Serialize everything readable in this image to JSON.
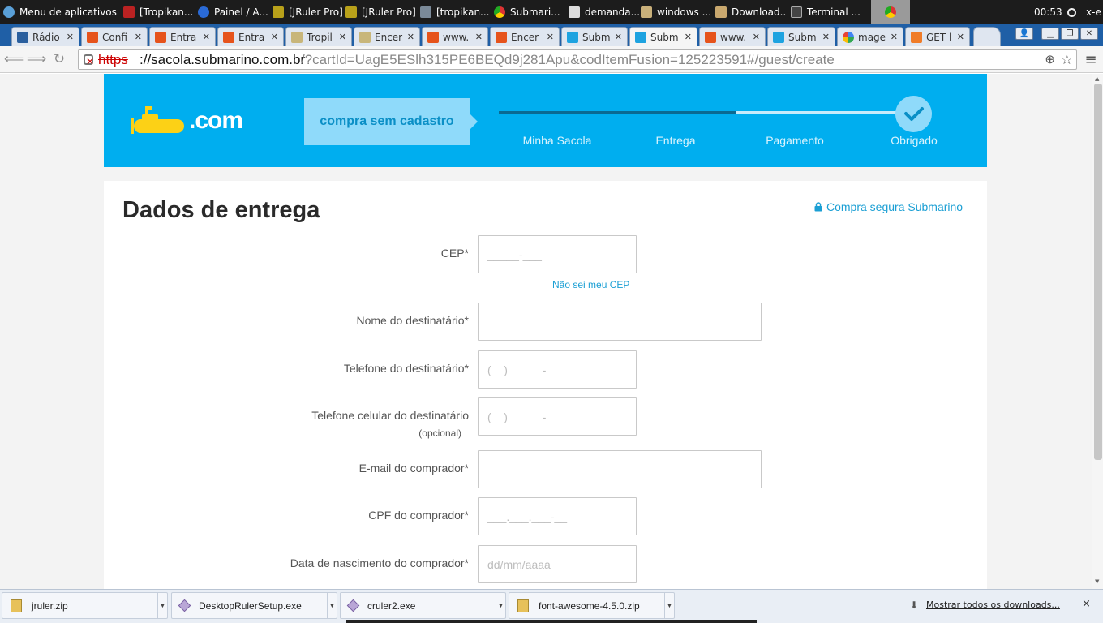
{
  "taskbar": {
    "apps_menu": "Menu de aplicativos",
    "items": [
      {
        "label": "[Tropikan..."
      },
      {
        "label": "Painel / A..."
      },
      {
        "label": "[JRuler Pro]"
      },
      {
        "label": "[JRuler Pro]"
      },
      {
        "label": "[tropikan..."
      },
      {
        "label": "Submari..."
      },
      {
        "label": "demanda..."
      },
      {
        "label": "windows ..."
      },
      {
        "label": "Download..."
      },
      {
        "label": "Terminal ..."
      }
    ],
    "clock": "00:53",
    "user": "x-e"
  },
  "tabs": [
    {
      "label": "Rádio"
    },
    {
      "label": "Confi"
    },
    {
      "label": "Entra"
    },
    {
      "label": "Entra"
    },
    {
      "label": "Tropil"
    },
    {
      "label": "Encer"
    },
    {
      "label": "www."
    },
    {
      "label": "Encer"
    },
    {
      "label": "Subm"
    },
    {
      "label": "Subm"
    },
    {
      "label": "www."
    },
    {
      "label": "Subm"
    },
    {
      "label": "mage"
    },
    {
      "label": "GET l"
    }
  ],
  "address_bar": {
    "scheme": "https",
    "host": "://sacola.submarino.com.br",
    "path": "/?cartId=UagE5ESlh315PE6BEQd9j281Apu&codItemFusion=125223591#/guest/create"
  },
  "header": {
    "logo_text": ".com",
    "checkout_label": "compra sem cadastro",
    "steps": [
      "Minha Sacola",
      "Entrega",
      "Pagamento",
      "Obrigado"
    ]
  },
  "form": {
    "title": "Dados de entrega",
    "secure_link": "Compra segura Submarino",
    "cep_label": "CEP*",
    "cep_placeholder": "_____-___",
    "cep_help": "Não sei meu CEP",
    "name_label": "Nome do destinatário*",
    "phone_label": "Telefone do destinatário*",
    "phone_placeholder": "(__) _____-____",
    "mobile_label": "Telefone celular do destinatário",
    "mobile_optional": "(opcional)",
    "mobile_placeholder": "(__) _____-____",
    "email_label": "E-mail do comprador*",
    "cpf_label": "CPF do comprador*",
    "cpf_placeholder": "___.___.___-__",
    "birth_label": "Data de nascimento do comprador*",
    "birth_placeholder": "dd/mm/aaaa"
  },
  "downloads": {
    "items": [
      {
        "name": "jruler.zip"
      },
      {
        "name": "DesktopRulerSetup.exe"
      },
      {
        "name": "cruler2.exe"
      },
      {
        "name": "font-awesome-4.5.0.zip"
      }
    ],
    "show_all": "Mostrar todos os downloads...",
    "close": "×"
  },
  "colors": {
    "brand_blue": "#00aeef",
    "brand_yellow": "#fcd116",
    "link_blue": "#1b9fd4"
  }
}
